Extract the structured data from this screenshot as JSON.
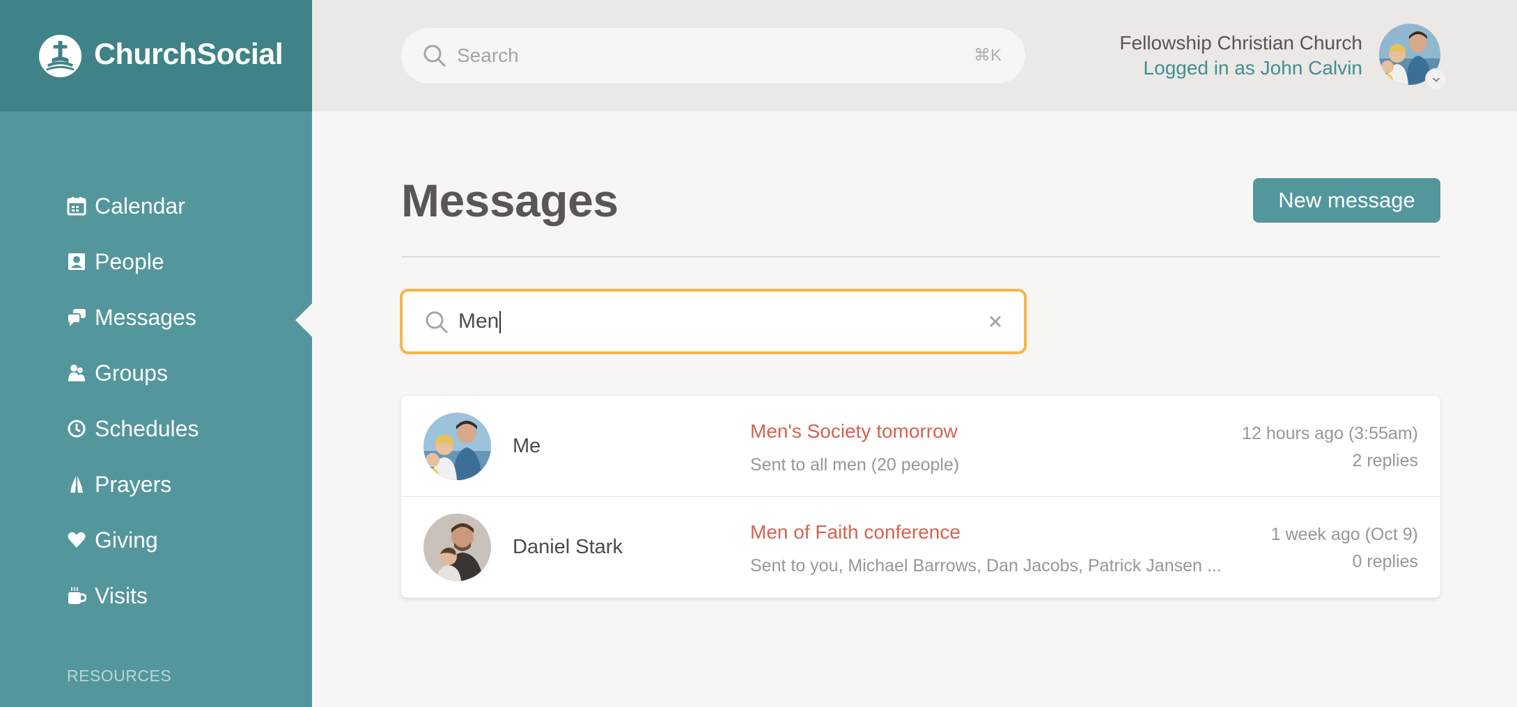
{
  "app": {
    "brand": "ChurchSocial"
  },
  "sidebar": {
    "items": [
      {
        "label": "Calendar",
        "icon": "calendar-icon"
      },
      {
        "label": "People",
        "icon": "person-card-icon"
      },
      {
        "label": "Messages",
        "icon": "chat-bubbles-icon",
        "active": true
      },
      {
        "label": "Groups",
        "icon": "group-icon"
      },
      {
        "label": "Schedules",
        "icon": "clock-icon"
      },
      {
        "label": "Prayers",
        "icon": "praying-hands-icon"
      },
      {
        "label": "Giving",
        "icon": "heart-icon"
      },
      {
        "label": "Visits",
        "icon": "coffee-cup-icon"
      }
    ],
    "section_heading": "RESOURCES"
  },
  "header": {
    "search_placeholder": "Search",
    "search_shortcut": "⌘K",
    "org_name": "Fellowship Christian Church",
    "logged_in": "Logged in as John Calvin"
  },
  "main": {
    "title": "Messages",
    "new_button": "New message",
    "search_value": "Men",
    "messages": [
      {
        "sender": "Me",
        "subject": "Men's Society tomorrow",
        "recipients": "Sent to all men (20 people)",
        "time": "12 hours ago (3:55am)",
        "replies": "2 replies"
      },
      {
        "sender": "Daniel Stark",
        "subject": "Men of Faith conference",
        "recipients": "Sent to you, Michael Barrows, Dan Jacobs, Patrick Jansen ...",
        "time": "1 week ago (Oct 9)",
        "replies": "0 replies"
      }
    ]
  },
  "colors": {
    "sidebar": "#53979c",
    "brand_bar": "#3f8287",
    "accent": "#53979c",
    "subject": "#d7614f",
    "search_focus": "#f6b546"
  }
}
